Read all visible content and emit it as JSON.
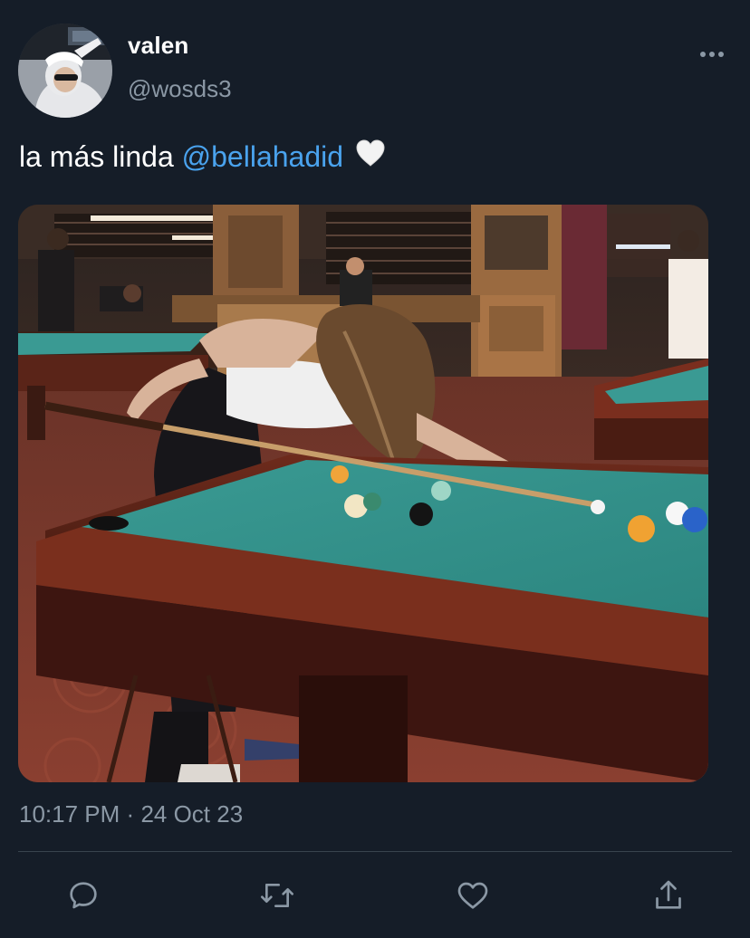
{
  "tweet": {
    "author": {
      "display_name": "valen",
      "handle": "@wosds3"
    },
    "text_before_mention": "la más linda ",
    "mention": "@bellahadid",
    "emoji": "white-heart",
    "media": {
      "description_icon": "pool-hall-photo"
    },
    "time": "10:17 PM",
    "separator": "·",
    "date": "24 Oct 23"
  },
  "actions": {
    "reply": "reply-icon",
    "retweet": "retweet-icon",
    "like": "like-icon",
    "share": "share-icon"
  },
  "colors": {
    "background": "#151d28",
    "mention": "#4aa3ee",
    "secondary_text": "#8b98a5",
    "divider": "#38444d"
  }
}
